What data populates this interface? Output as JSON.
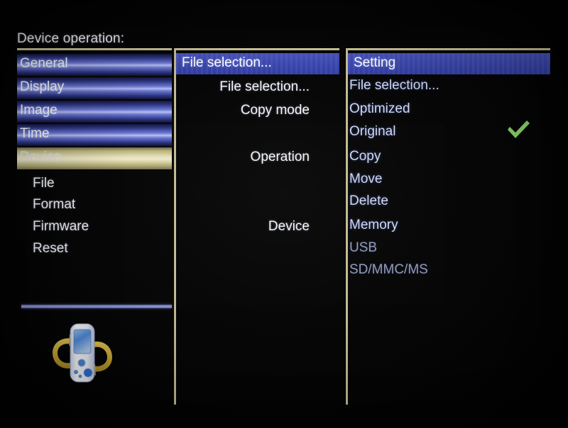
{
  "screen": {
    "title": "Device operation:",
    "background_color": "#050505",
    "accent_divider_color": "#ddd7ad",
    "header_bar_color": "#3a46ae",
    "check_color": "#8ed46a"
  },
  "left_column": {
    "name": "category-list",
    "rows": [
      {
        "label": "General",
        "state": "normal"
      },
      {
        "label": "Display",
        "state": "normal"
      },
      {
        "label": "Image",
        "state": "normal"
      },
      {
        "label": "Time",
        "state": "normal"
      },
      {
        "label": "Device",
        "state": "selected"
      }
    ],
    "sub_items": [
      {
        "label": "File"
      },
      {
        "label": "Format"
      },
      {
        "label": "Firmware"
      },
      {
        "label": "Reset"
      }
    ],
    "device_icon_name": "portable-media-player-rotate-icon"
  },
  "middle_column": {
    "header": "File selection...",
    "items": [
      {
        "label": "File selection..."
      },
      {
        "label": "Copy mode"
      },
      {
        "label": "Operation"
      },
      {
        "label": "Device"
      }
    ]
  },
  "right_column": {
    "header": "Setting",
    "items": [
      {
        "label": "File selection...",
        "state": "enabled",
        "checked": false
      },
      {
        "label": "Optimized",
        "state": "enabled",
        "checked": false
      },
      {
        "label": "Original",
        "state": "enabled",
        "checked": true
      },
      {
        "label": "Copy",
        "state": "enabled",
        "checked": false
      },
      {
        "label": "Move",
        "state": "enabled",
        "checked": false
      },
      {
        "label": "Delete",
        "state": "enabled",
        "checked": false
      },
      {
        "label": "Memory",
        "state": "enabled",
        "checked": false
      },
      {
        "label": "USB",
        "state": "disabled",
        "checked": false
      },
      {
        "label": "SD/MMC/MS",
        "state": "disabled",
        "checked": false
      }
    ],
    "check_icon_name": "checkmark-icon"
  }
}
